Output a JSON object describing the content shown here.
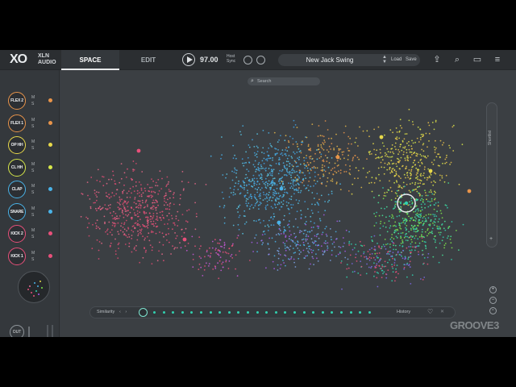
{
  "topbar": {
    "logo_xo": "XO",
    "logo_brand_line1": "XLN",
    "logo_brand_line2": "AUDIO",
    "tabs": [
      {
        "label": "SPACE",
        "active": true
      },
      {
        "label": "EDIT",
        "active": false
      }
    ],
    "tempo": "97.00",
    "host_sync_line1": "Host",
    "host_sync_line2": "Sync",
    "preset_name": "New Jack Swing",
    "load_label": "Load",
    "save_label": "Save",
    "icons": [
      "play-icon",
      "metronome-icon",
      "link-icon",
      "share-icon",
      "search-icon",
      "folder-icon",
      "menu-icon"
    ]
  },
  "tracks": [
    {
      "name": "FLEX 2",
      "color": "#e8944a"
    },
    {
      "name": "FLEX 1",
      "color": "#e8944a"
    },
    {
      "name": "OP HH",
      "color": "#e8d94a"
    },
    {
      "name": "CL HH",
      "color": "#d7e84a"
    },
    {
      "name": "CLAP",
      "color": "#4ab3e8"
    },
    {
      "name": "SNARE",
      "color": "#4ab3e8"
    },
    {
      "name": "KICK 2",
      "color": "#e8507a"
    },
    {
      "name": "KICK 1",
      "color": "#e8507a"
    }
  ],
  "track_mute_label": "M",
  "track_solo_label": "S",
  "output": {
    "label": "OUT"
  },
  "space": {
    "search_placeholder": "Search",
    "shortlist_label": "Shortlist",
    "shortlist_add": "+"
  },
  "sequencer": {
    "similarity_label": "Similarity",
    "history_label": "History",
    "step_count": 24,
    "current_step": 1,
    "accent_color": "#31d0ae"
  },
  "watermark": "GROOVE3"
}
